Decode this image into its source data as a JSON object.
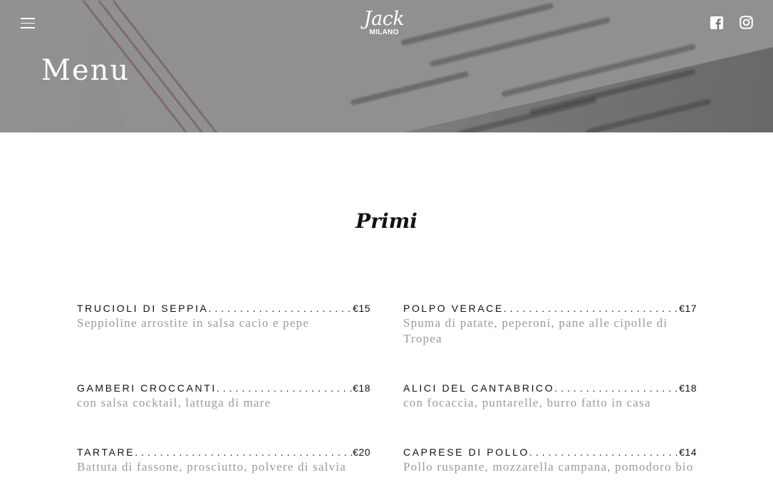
{
  "header": {
    "logo_script": "Jack",
    "logo_sub": "MILANO",
    "menu_icon": "hamburger-icon",
    "social": [
      {
        "name": "facebook",
        "icon": "facebook-icon"
      },
      {
        "name": "instagram",
        "icon": "instagram-icon"
      }
    ]
  },
  "hero": {
    "title": "Menu"
  },
  "section": {
    "title": "Primi"
  },
  "items": [
    {
      "name": "TRUCIOLI DI SEPPIA",
      "price": "€15",
      "desc": "Seppioline arrostite in salsa cacio e pepe"
    },
    {
      "name": "POLPO VERACE",
      "price": "€17",
      "desc": "Spuma di patate, peperoni, pane alle cipolle di Tropea"
    },
    {
      "name": "GAMBERI CROCCANTI",
      "price": "€18",
      "desc": "con salsa cocktail, lattuga di mare"
    },
    {
      "name": "ALICI DEL CANTABRICO",
      "price": "€18",
      "desc": "con focaccia, puntarelle, burro fatto in casa"
    },
    {
      "name": "TARTARE",
      "price": "€20",
      "desc": "Battuta di fassone, prosciutto, polvere di salvia"
    },
    {
      "name": "CAPRESE DI POLLO",
      "price": "€14",
      "desc": "Pollo ruspante, mozzarella campana, pomodoro bio"
    }
  ],
  "colors": {
    "accent": "#111111",
    "description": "#9a9a9a",
    "hero_text": "#ffffff"
  }
}
